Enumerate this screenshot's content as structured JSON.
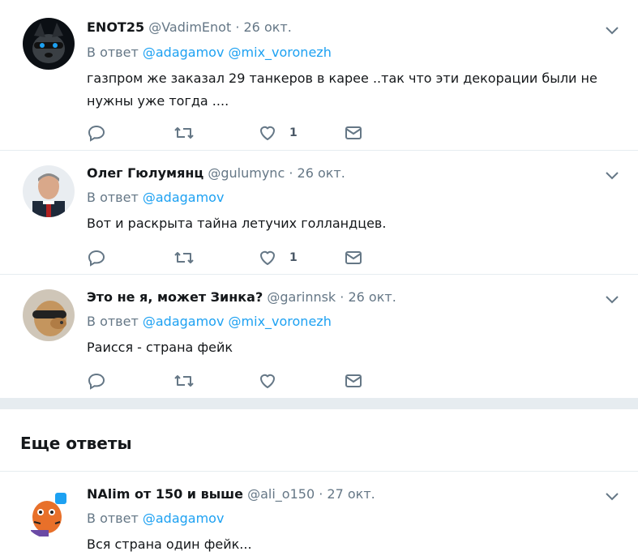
{
  "tweets": [
    {
      "name": "ENOT25",
      "handle": "@VadimEnot",
      "date": "26 окт.",
      "reply_prefix": "В ответ",
      "mentions": [
        "@adagamov",
        "@mix_voronezh"
      ],
      "text_lines": [
        "газпром же заказал 29 танкеров в карее ..так что эти декорации были не",
        "нужны уже тогда ...."
      ],
      "like_count": "1"
    },
    {
      "name": "Олег Гюлумянц",
      "handle": "@gulumync",
      "date": "26 окт.",
      "reply_prefix": "В ответ",
      "mentions": [
        "@adagamov"
      ],
      "text_lines": [
        "Вот и раскрыта тайна летучих голландцев."
      ],
      "like_count": "1"
    },
    {
      "name": "Это не я, может Зинка?",
      "handle": "@garinnsk",
      "date": "26 окт.",
      "reply_prefix": "В ответ",
      "mentions": [
        "@adagamov",
        "@mix_voronezh"
      ],
      "text_lines": [
        "Раисся - страна фейк"
      ],
      "like_count": ""
    },
    {
      "name": "NAlim от 150 и выше",
      "handle": "@ali_o150",
      "date": "27 окт.",
      "reply_prefix": "В ответ",
      "mentions": [
        "@adagamov"
      ],
      "text_lines": [
        "Вся страна один фейк..."
      ],
      "like_count": ""
    }
  ],
  "more_replies_title": "Еще ответы",
  "separator": "·",
  "icons": {
    "reply": "reply-icon",
    "retweet": "retweet-icon",
    "like": "heart-icon",
    "dm": "envelope-icon",
    "menu": "chevron-down-icon"
  },
  "colors": {
    "link": "#1da1f2",
    "muted": "#657786",
    "icon": "#657786",
    "divider": "#e6ecf0"
  }
}
